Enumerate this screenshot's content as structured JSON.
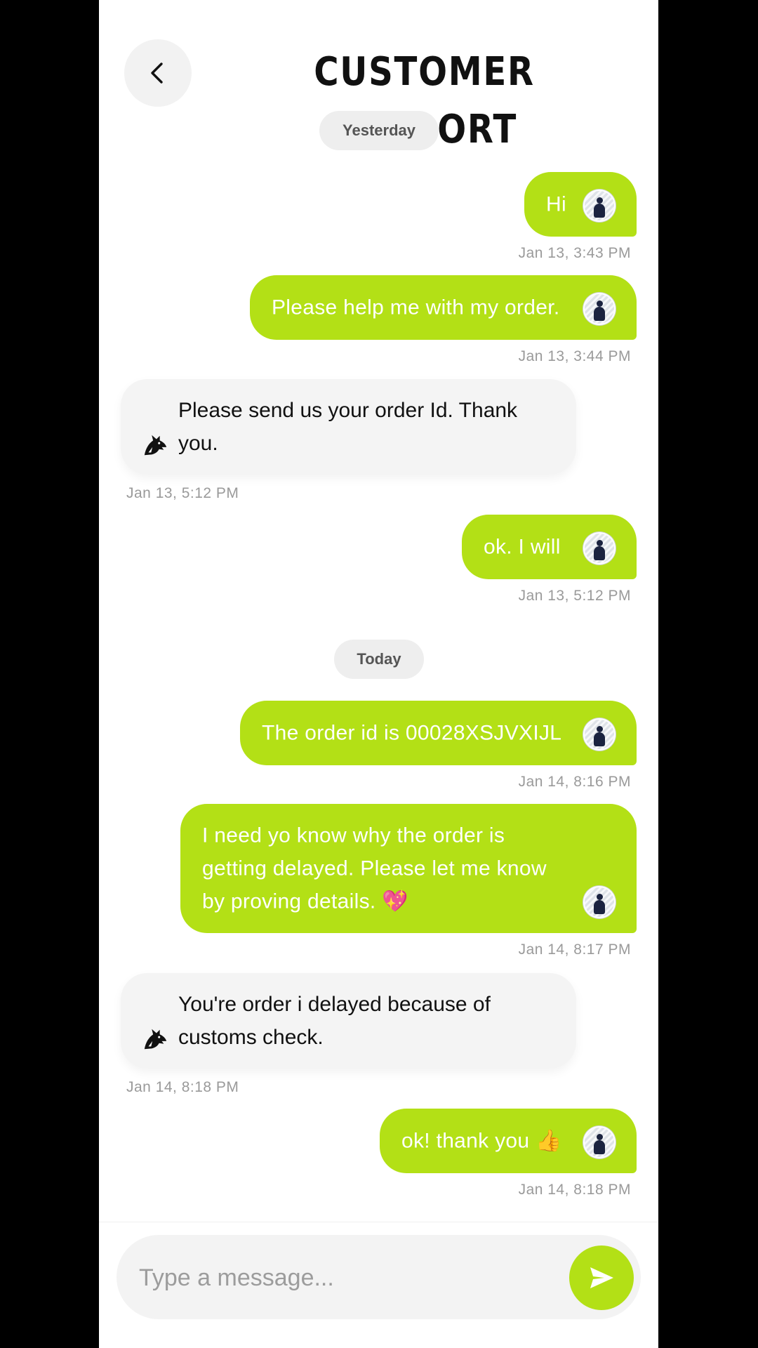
{
  "header": {
    "title": "CUSTOMER SUPPORT",
    "back_icon": "chevron-left-icon"
  },
  "colors": {
    "accent": "#b3e016",
    "incoming_bubble": "#f4f4f4",
    "chip": "#eeeeee",
    "timestamp": "#9a9a9a"
  },
  "date_chips": [
    "Yesterday",
    "Today"
  ],
  "messages": [
    {
      "from": "me",
      "text": "Hi",
      "time": "Jan 13, 3:43 PM"
    },
    {
      "from": "me",
      "text": "Please help me with my order.",
      "time": "Jan 13, 3:44 PM"
    },
    {
      "from": "support",
      "text": "Please send us your order Id. Thank you.",
      "time": "Jan 13, 5:12 PM"
    },
    {
      "from": "me",
      "text": "ok. I will",
      "time": "Jan 13, 5:12 PM"
    },
    {
      "from": "me",
      "text": "The order id is 00028XSJVXIJL",
      "time": "Jan 14, 8:16 PM"
    },
    {
      "from": "me",
      "text": "I need yo know why the order is getting delayed. Please let me know by proving details. 💖",
      "time": "Jan 14, 8:17 PM"
    },
    {
      "from": "support",
      "text": "You're order i delayed because of customs check.",
      "time": "Jan 14, 8:18 PM"
    },
    {
      "from": "me",
      "text": "ok! thank you 👍",
      "time": "Jan 14, 8:18 PM"
    }
  ],
  "composer": {
    "placeholder": "Type a message...",
    "send_icon": "send-icon"
  }
}
